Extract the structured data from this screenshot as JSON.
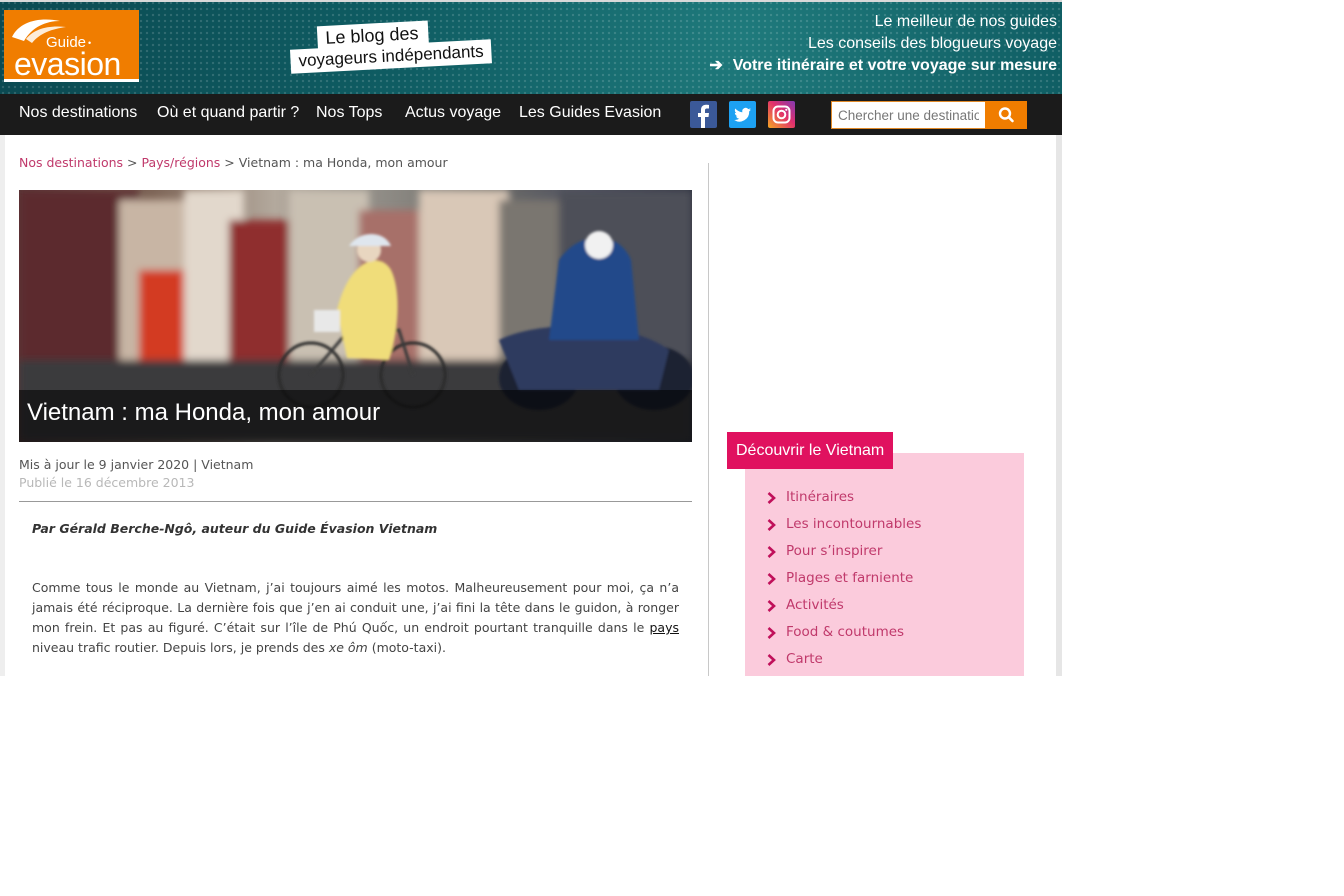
{
  "header": {
    "logo_small": "Guide",
    "logo_big": "evasion",
    "badge_line1": "Le blog des",
    "badge_line2": "voyageurs indépendants",
    "tagline1": "Le meilleur de nos guides",
    "tagline2": "Les conseils des blogueurs voyage",
    "tagline3": "Votre itinéraire et votre voyage sur mesure"
  },
  "nav": {
    "items": [
      "Nos destinations",
      "Où et quand partir ?",
      "Nos Tops",
      "Actus voyage",
      "Les Guides Evasion"
    ],
    "search_placeholder": "Chercher une destination"
  },
  "breadcrumb": {
    "item1": "Nos destinations",
    "item2": "Pays/régions",
    "current": "Vietnam : ma Honda, mon amour",
    "separator": ">"
  },
  "article": {
    "title": "Vietnam : ma Honda, mon amour",
    "updated": "Mis à jour le 9 janvier 2020 | Vietnam",
    "published": "Publié le 16 décembre 2013",
    "author": "Par Gérald Berche-Ngô, auteur du Guide Évasion Vietnam",
    "para_part1": "Comme tous le monde au Vietnam, j’ai toujours aimé les motos. Malheureusement pour moi, ça n’a jamais été réciproque. La dernière fois que j’en ai conduit une, j’ai fini la tête dans le guidon, à ronger mon frein. Et pas au figuré. C’était sur l’île de Phú Quốc, un endroit pourtant tranquille dans le ",
    "para_link": "pays",
    "para_part2": " niveau trafic routier. Depuis lors, je prends des ",
    "para_italic": "xe ôm",
    "para_part3": " (moto-taxi)."
  },
  "sidebar": {
    "discover_title": "Découvrir le Vietnam",
    "items": [
      "Itinéraires",
      "Les incontournables",
      "Pour s’inspirer",
      "Plages et farniente",
      "Activités",
      "Food & coutumes",
      "Carte"
    ]
  },
  "colors": {
    "brand_orange": "#f07d00",
    "accent_pink": "#e0115f",
    "sidebar_pink_bg": "#fbcbdc",
    "link_pink": "#c0396b",
    "nav_bg": "#1b1b1b"
  },
  "icons": [
    "facebook-icon",
    "twitter-icon",
    "instagram-icon",
    "search-icon",
    "chevron-right-icon",
    "arrow-right-icon"
  ]
}
